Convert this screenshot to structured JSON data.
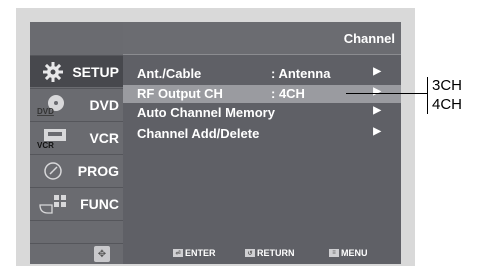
{
  "header": {
    "title": "Channel"
  },
  "sidebar": {
    "items": [
      {
        "label": "SETUP",
        "icon": "gear-icon",
        "active": true
      },
      {
        "label": "DVD",
        "icon": "dvd-disc-icon",
        "icon_text": "DVD",
        "active": false
      },
      {
        "label": "VCR",
        "icon": "vcr-tape-icon",
        "icon_text": "VCR",
        "active": false
      },
      {
        "label": "PROG",
        "icon": "clock-icon",
        "active": false
      },
      {
        "label": "FUNC",
        "icon": "remote-hand-icon",
        "active": false
      }
    ],
    "nav_icon": "directional-arrows-icon"
  },
  "menu": {
    "items": [
      {
        "label": "Ant./Cable",
        "value": ": Antenna",
        "arrow": "▶",
        "highlighted": false
      },
      {
        "label": "RF Output CH",
        "value": ": 4CH",
        "arrow": "▶",
        "highlighted": true
      },
      {
        "label": "Auto Channel Memory",
        "value": "",
        "arrow": "▶",
        "highlighted": false
      },
      {
        "label": "Channel Add/Delete",
        "value": "",
        "arrow": "▶",
        "highlighted": false
      }
    ]
  },
  "footer": {
    "hints": [
      {
        "label": "ENTER",
        "icon": "enter-icon"
      },
      {
        "label": "RETURN",
        "icon": "return-icon"
      },
      {
        "label": "MENU",
        "icon": "menu-icon"
      }
    ]
  },
  "callout": {
    "options": [
      "3CH",
      "4CH"
    ]
  },
  "colors": {
    "screen_bg": "#5f6066",
    "highlight": "#9a9ba0",
    "text": "#ffffff"
  }
}
